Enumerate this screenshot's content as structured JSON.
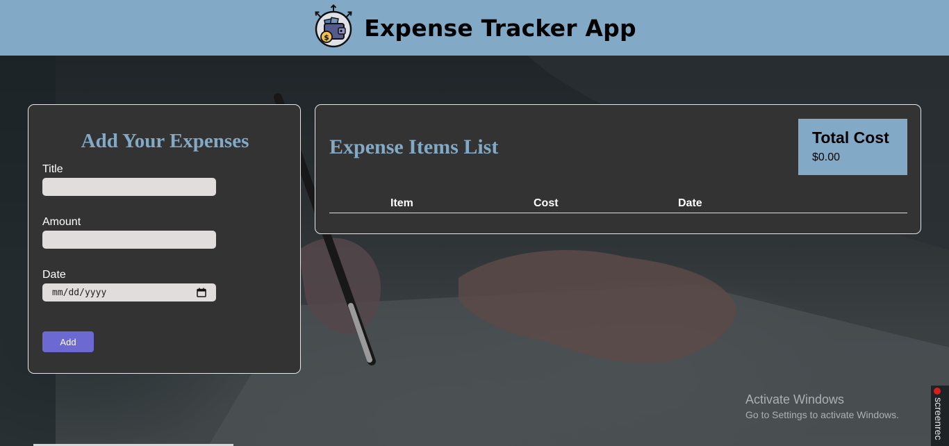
{
  "header": {
    "title": "Expense Tracker App",
    "logo_icon": "wallet-money-icon"
  },
  "form": {
    "title": "Add Your Expenses",
    "title_field": {
      "label": "Title",
      "value": ""
    },
    "amount_field": {
      "label": "Amount",
      "value": ""
    },
    "date_field": {
      "label": "Date",
      "placeholder": "mm/dd/yyyy",
      "icon": "calendar-icon"
    },
    "add_button": "Add"
  },
  "list": {
    "title": "Expense Items List",
    "total_label": "Total Cost",
    "total_value": "$0.00",
    "columns": [
      "Item",
      "Cost",
      "Date"
    ],
    "rows": []
  },
  "watermark": {
    "title": "Activate Windows",
    "subtitle": "Go to Settings to activate Windows."
  },
  "recorder": {
    "label": "screenrec"
  },
  "colors": {
    "header": "#82aac6",
    "panel": "#333333",
    "accent_button": "#6c69d3",
    "input": "#e1dddd"
  }
}
